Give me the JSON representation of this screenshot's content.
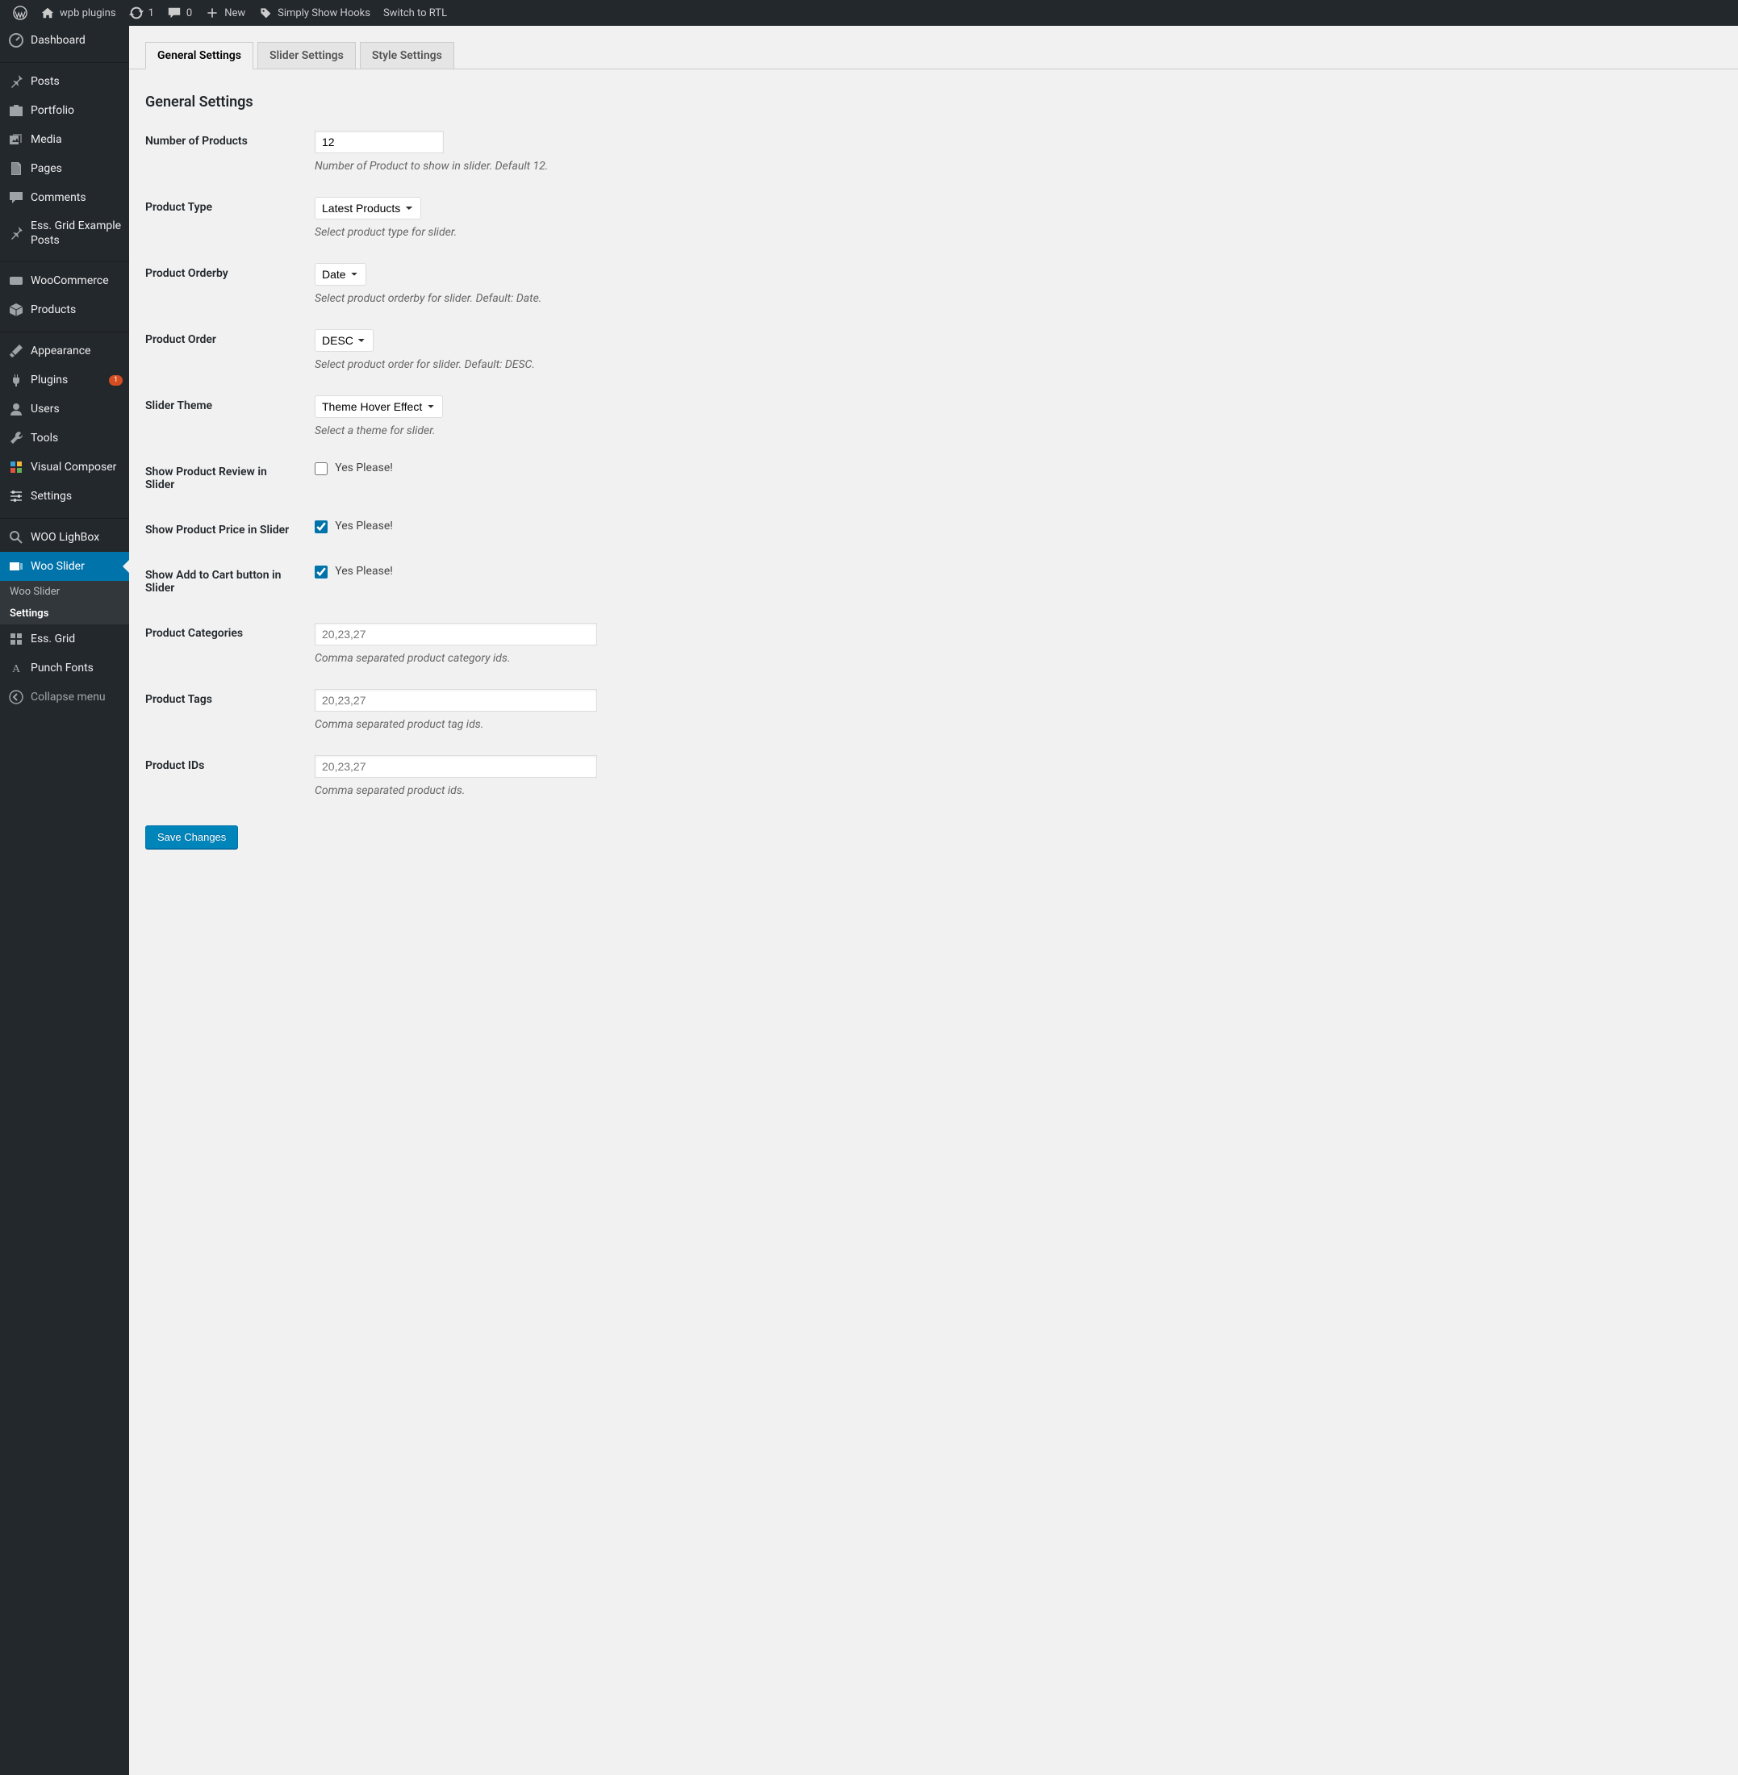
{
  "adminbar": {
    "site": "wpb plugins",
    "updates": "1",
    "comments": "0",
    "new": "New",
    "hooks": "Simply Show Hooks",
    "rtl": "Switch to RTL"
  },
  "sidebar": {
    "items": [
      {
        "label": "Dashboard",
        "icon": "dashboard"
      },
      {
        "sep": true
      },
      {
        "label": "Posts",
        "icon": "pin"
      },
      {
        "label": "Portfolio",
        "icon": "portfolio"
      },
      {
        "label": "Media",
        "icon": "media"
      },
      {
        "label": "Pages",
        "icon": "pages"
      },
      {
        "label": "Comments",
        "icon": "comment"
      },
      {
        "label": "Ess. Grid Example Posts",
        "icon": "pin"
      },
      {
        "sep": true
      },
      {
        "label": "WooCommerce",
        "icon": "woo"
      },
      {
        "label": "Products",
        "icon": "box"
      },
      {
        "sep": true
      },
      {
        "label": "Appearance",
        "icon": "brush"
      },
      {
        "label": "Plugins",
        "icon": "plug",
        "badge": "1"
      },
      {
        "label": "Users",
        "icon": "user"
      },
      {
        "label": "Tools",
        "icon": "wrench"
      },
      {
        "label": "Visual Composer",
        "icon": "vc"
      },
      {
        "label": "Settings",
        "icon": "sliders"
      },
      {
        "sep": true
      },
      {
        "label": "WOO LighBox",
        "icon": "search"
      },
      {
        "label": "Woo Slider",
        "icon": "wooslider",
        "active": true
      },
      {
        "label": "Ess. Grid",
        "icon": "grid"
      },
      {
        "label": "Punch Fonts",
        "icon": "font"
      },
      {
        "label": "Collapse menu",
        "icon": "collapse",
        "muted": true
      }
    ],
    "submenu": [
      {
        "label": "Woo Slider"
      },
      {
        "label": "Settings",
        "current": true
      }
    ]
  },
  "tabs": [
    "General Settings",
    "Slider Settings",
    "Style Settings"
  ],
  "page": {
    "title": "General Settings"
  },
  "form": {
    "numProducts": {
      "label": "Number of Products",
      "value": "12",
      "desc": "Number of Product to show in slider. Default 12."
    },
    "productType": {
      "label": "Product Type",
      "value": "Latest Products",
      "desc": "Select product type for slider."
    },
    "orderby": {
      "label": "Product Orderby",
      "value": "Date",
      "desc": "Select product orderby for slider. Default: Date."
    },
    "order": {
      "label": "Product Order",
      "value": "DESC",
      "desc": "Select product order for slider. Default: DESC."
    },
    "theme": {
      "label": "Slider Theme",
      "value": "Theme Hover Effect",
      "desc": "Select a theme for slider."
    },
    "review": {
      "label": "Show Product Review in Slider",
      "checklabel": "Yes Please!",
      "checked": false
    },
    "price": {
      "label": "Show Product Price in Slider",
      "checklabel": "Yes Please!",
      "checked": true
    },
    "cart": {
      "label": "Show Add to Cart button in Slider",
      "checklabel": "Yes Please!",
      "checked": true
    },
    "cats": {
      "label": "Product Categories",
      "placeholder": "20,23,27",
      "desc": "Comma separated product category ids."
    },
    "tags": {
      "label": "Product Tags",
      "placeholder": "20,23,27",
      "desc": "Comma separated product tag ids."
    },
    "ids": {
      "label": "Product IDs",
      "placeholder": "20,23,27",
      "desc": "Comma separated product ids."
    },
    "submit": "Save Changes"
  }
}
